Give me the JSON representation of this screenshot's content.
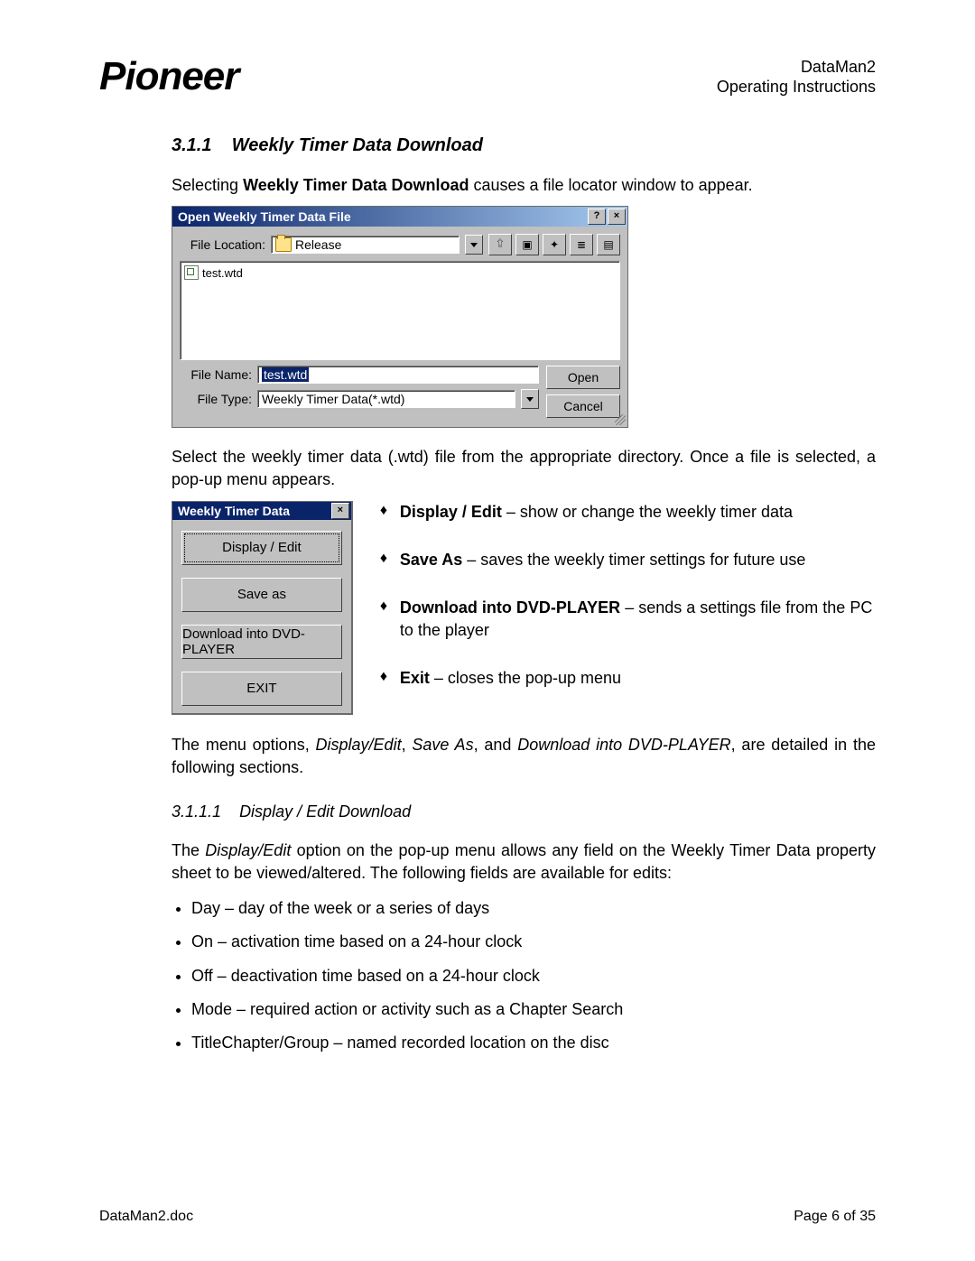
{
  "header": {
    "logo": "Pioneer",
    "title": "DataMan2",
    "subtitle": "Operating Instructions"
  },
  "section": {
    "number": "3.1.1",
    "title": "Weekly Timer Data Download",
    "intro_pre": "Selecting ",
    "intro_bold": "Weekly Timer Data Download",
    "intro_post": " causes a file locator window to appear."
  },
  "file_dialog": {
    "title": "Open Weekly Timer Data File",
    "help_btn": "?",
    "close_btn": "×",
    "location_label": "File Location:",
    "location_value": "Release",
    "file_entry": "test.wtd",
    "filename_label": "File Name:",
    "filename_value": "test.wtd",
    "filetype_label": "File Type:",
    "filetype_value": "Weekly Timer Data(*.wtd)",
    "open_btn": "Open",
    "cancel_btn": "Cancel",
    "toolbar_icons": [
      "up-folder-icon",
      "desktop-icon",
      "new-folder-icon",
      "list-view-icon",
      "details-view-icon"
    ]
  },
  "para2": "Select the weekly timer data (.wtd) file from the appropriate directory. Once a file is selected, a pop-up menu appears.",
  "popup": {
    "title": "Weekly Timer Data",
    "close_btn": "×",
    "buttons": [
      "Display / Edit",
      "Save as",
      "Download into DVD-PLAYER",
      "EXIT"
    ]
  },
  "popup_desc": [
    {
      "bold": "Display / Edit",
      "text": " – show or change the weekly timer data"
    },
    {
      "bold": "Save As",
      "text": " – saves the weekly timer settings for future use"
    },
    {
      "bold": "Download into DVD-PLAYER",
      "text": " – sends a settings file from the PC to the player"
    },
    {
      "bold": "Exit",
      "text": " – closes the pop-up menu"
    }
  ],
  "para3_pre": "The menu options, ",
  "para3_i1": "Display/Edit",
  "para3_m1": ", ",
  "para3_i2": "Save As",
  "para3_m2": ", and ",
  "para3_i3": "Download into DVD-PLAYER",
  "para3_post": ", are detailed in the following sections.",
  "subsection": {
    "number": "3.1.1.1",
    "title": "Display / Edit Download",
    "intro_pre": "The ",
    "intro_i": "Display/Edit",
    "intro_post": " option on the pop-up menu allows any field on the Weekly Timer Data property sheet to be viewed/altered. The following fields are available for edits:",
    "bullets": [
      "Day – day of the week or a series of days",
      "On – activation time based on a 24-hour clock",
      "Off – deactivation time based on a 24-hour clock",
      "Mode – required action or activity such as a Chapter Search",
      "TitleChapter/Group – named recorded location on the disc"
    ]
  },
  "footer": {
    "left": "DataMan2.doc",
    "right": "Page 6 of 35"
  }
}
